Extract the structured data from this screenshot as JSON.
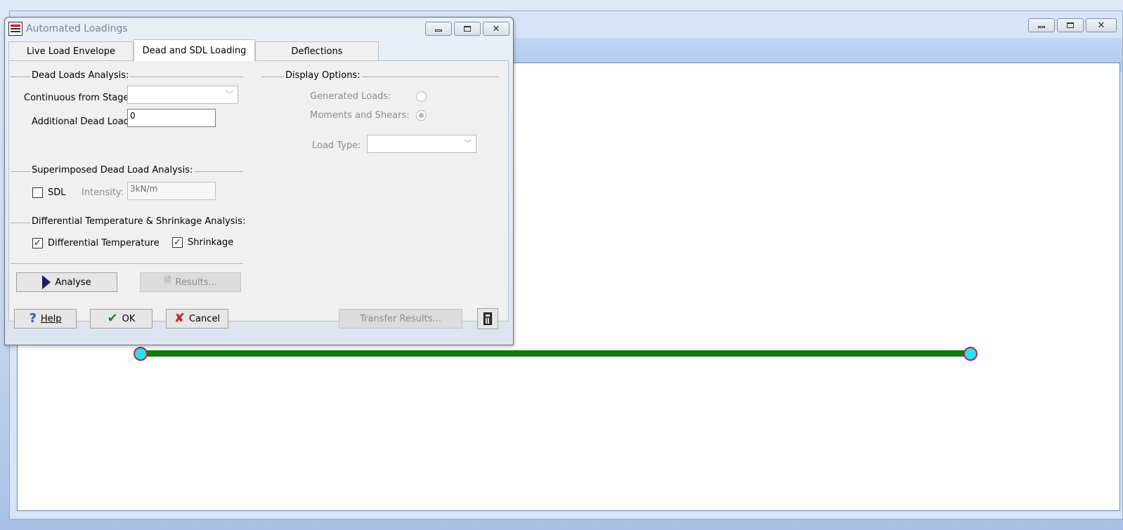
{
  "background_window": {
    "controls": [
      "minimize",
      "maximize",
      "close"
    ]
  },
  "model": {
    "beam_color": "#0b7d0b",
    "node_fill": "#22e3f3",
    "node_stroke": "#c2233b"
  },
  "dialog": {
    "title": "Automated Loadings",
    "tabs": [
      {
        "label": "Live Load Envelope",
        "active": false
      },
      {
        "label": "Dead and SDL Loading",
        "active": true
      },
      {
        "label": "Deflections",
        "active": false
      }
    ],
    "dead_loads": {
      "group_label": "Dead Loads Analysis:",
      "continuous_label": "Continuous from Stage:",
      "continuous_value": "",
      "additional_label": "Additional Dead Load:",
      "additional_value": "0"
    },
    "display_options": {
      "group_label": "Display Options:",
      "generated_loads_label": "Generated Loads:",
      "generated_loads_selected": false,
      "moments_label": "Moments and Shears:",
      "moments_selected": true,
      "load_type_label": "Load Type:",
      "load_type_value": ""
    },
    "sdl": {
      "group_label": "Superimposed Dead Load Analysis:",
      "sdl_label": "SDL",
      "sdl_checked": false,
      "intensity_label": "Intensity:",
      "intensity_value": "3kN/m"
    },
    "diff_temp": {
      "group_label": "Differential Temperature & Shrinkage Analysis:",
      "diff_temp_label": "Differential Temperature",
      "diff_temp_checked": true,
      "shrinkage_label": "Shrinkage",
      "shrinkage_checked": true
    },
    "analyse_button": "Analyse",
    "results_button": "Results...",
    "help_button": "Help",
    "ok_button": "OK",
    "cancel_button": "Cancel",
    "transfer_button": "Transfer Results..."
  }
}
